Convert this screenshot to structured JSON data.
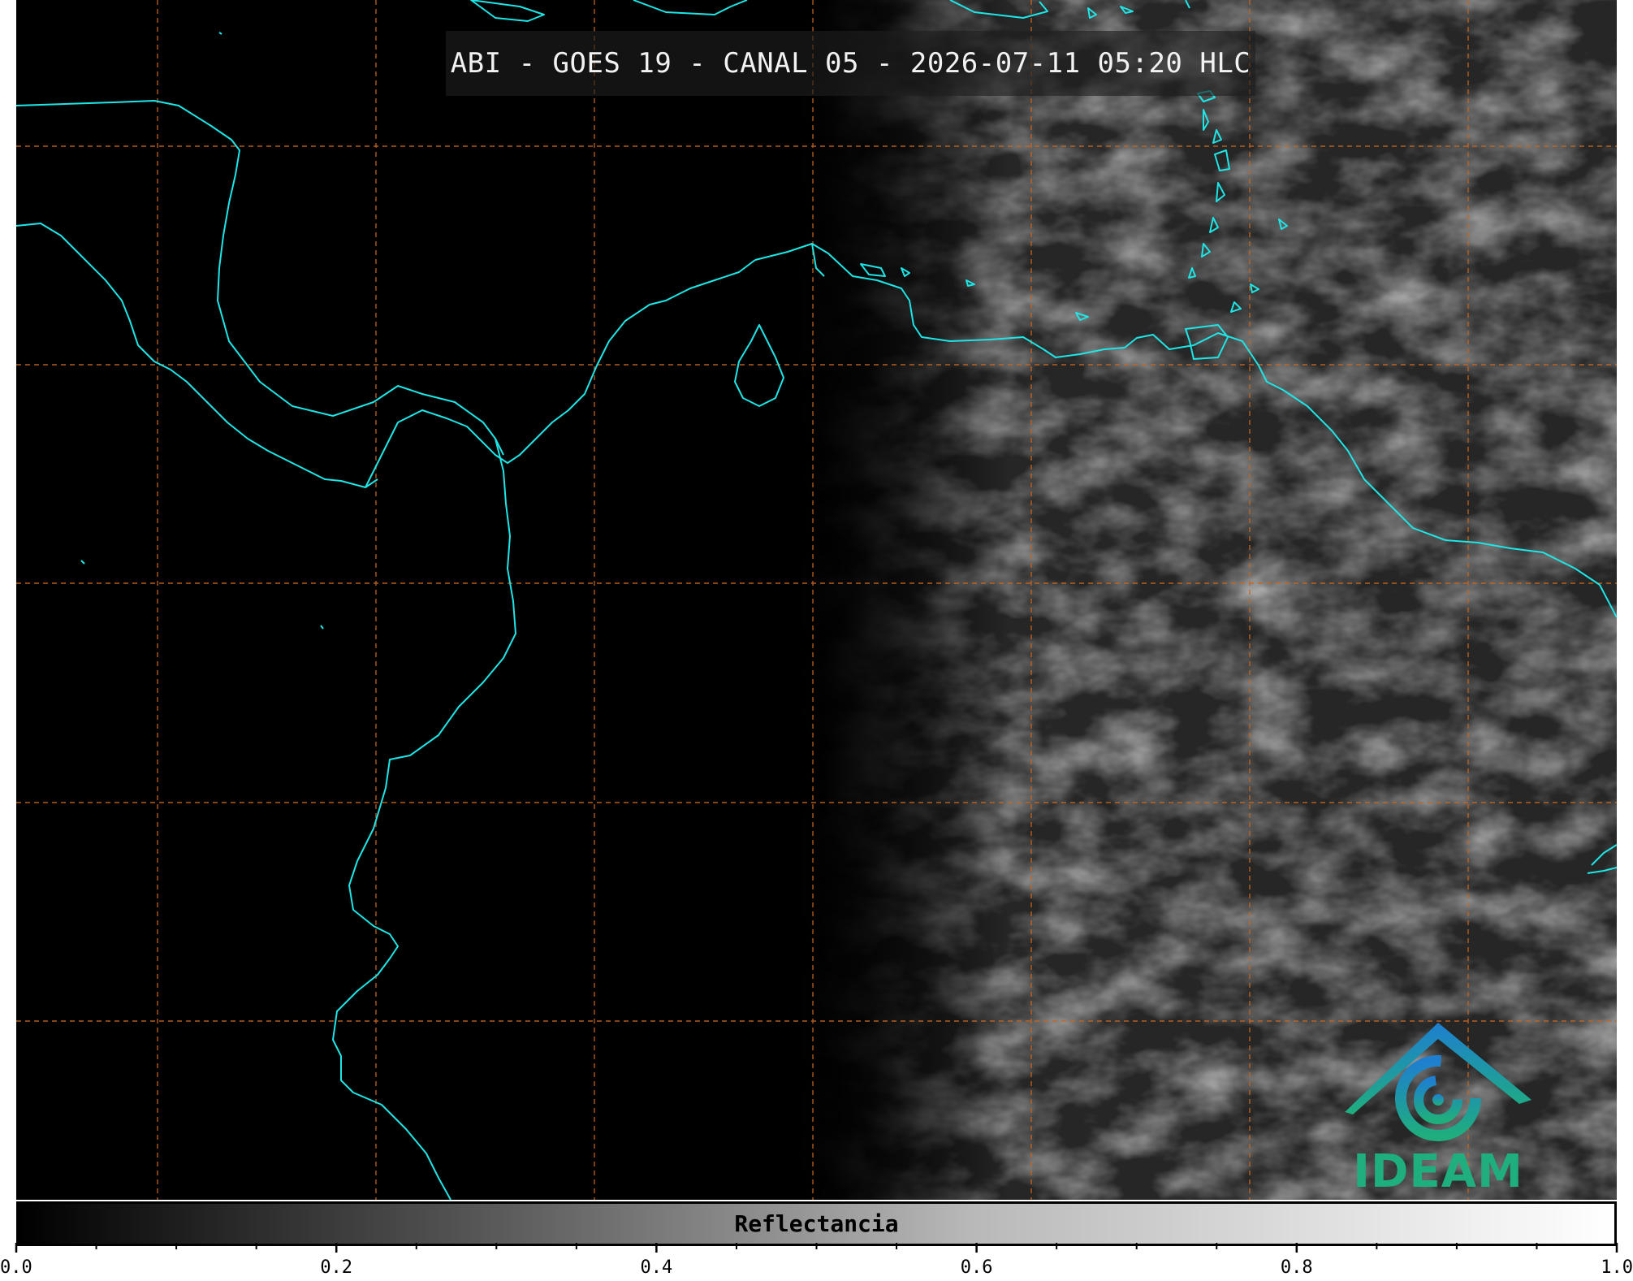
{
  "title": "ABI - GOES 19 - CANAL 05 - 2026-07-11 05:20 HLC",
  "logo": {
    "text": "IDEAM",
    "icon": "ideam-logo-icon"
  },
  "colorbar": {
    "label": "Reflectancia",
    "min": 0.0,
    "max": 1.0,
    "tick_labels": [
      "0.0",
      "0.2",
      "0.4",
      "0.6",
      "0.8",
      "1.0"
    ],
    "major_ticks": [
      0.0,
      0.2,
      0.4,
      0.6,
      0.8,
      1.0
    ],
    "minor_step": 0.05
  },
  "colors": {
    "coastline": "#1ee6e6",
    "gridline": "#c8651e",
    "background": "#000000",
    "logo_blue": "#1e7fd0",
    "logo_green": "#1fae7d"
  }
}
